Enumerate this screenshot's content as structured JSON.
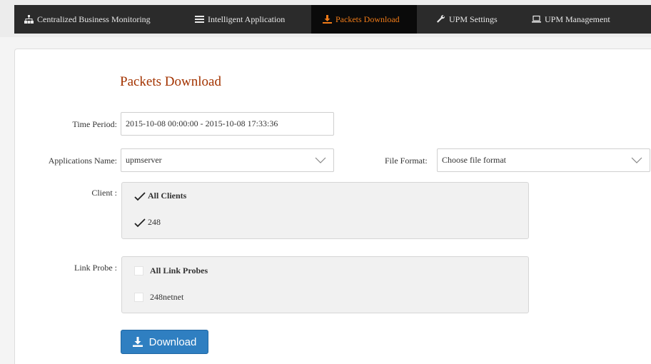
{
  "nav": {
    "items": [
      {
        "label": "Centralized Business Monitoring",
        "icon": "sitemap-icon",
        "active": false
      },
      {
        "label": "Intelligent Application",
        "icon": "list-icon",
        "active": false
      },
      {
        "label": "Packets Download",
        "icon": "download-icon",
        "active": true
      },
      {
        "label": "UPM Settings",
        "icon": "wrench-icon",
        "active": false
      },
      {
        "label": "UPM Management",
        "icon": "laptop-icon",
        "active": false
      }
    ],
    "active_color": "#f07b18"
  },
  "page": {
    "title": "Packets Download",
    "title_color": "#a33300"
  },
  "form": {
    "time_period": {
      "label": "Time Period:",
      "value": "2015-10-08 00:00:00 - 2015-10-08 17:33:36"
    },
    "applications": {
      "label": "Applications Name:",
      "value": "upmserver"
    },
    "file_format": {
      "label": "File Format:",
      "value": "Choose file format"
    },
    "client": {
      "label": "Client :",
      "all_label": "All Clients",
      "all_checked": true,
      "items": [
        {
          "label": "248",
          "checked": true
        }
      ]
    },
    "link_probe": {
      "label": "Link Probe :",
      "all_label": "All Link Probes",
      "all_checked": false,
      "items": [
        {
          "label": "248netnet",
          "checked": false
        }
      ]
    }
  },
  "download_button": {
    "label": "Download",
    "icon": "download-icon",
    "color": "#2f7fc1"
  }
}
